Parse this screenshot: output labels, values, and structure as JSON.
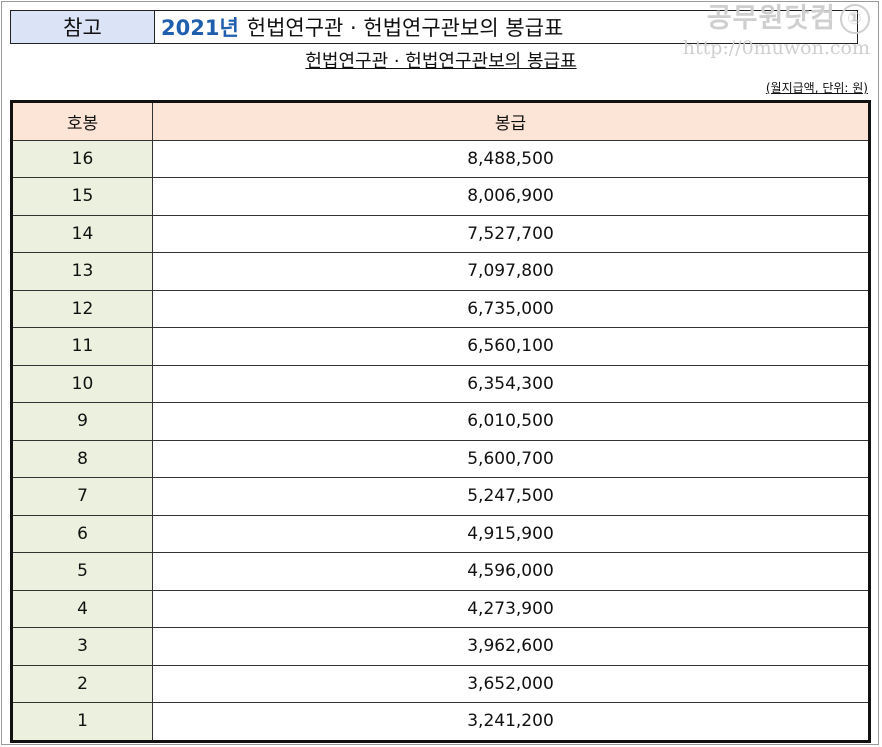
{
  "header": {
    "tag": "참고",
    "year": "2021년",
    "title": "헌법연구관 · 헌법연구관보의 봉급표"
  },
  "watermark": {
    "name": "공무원닷컴",
    "icon": "①",
    "url": "http://0muwon.com"
  },
  "subtitle": "헌법연구관 · 헌법연구관보의 봉급표",
  "unit_note": "(월지급액, 단위: 원)",
  "table": {
    "columns": [
      "호봉",
      "봉급"
    ],
    "rows": [
      {
        "step": "16",
        "pay": "8,488,500"
      },
      {
        "step": "15",
        "pay": "8,006,900"
      },
      {
        "step": "14",
        "pay": "7,527,700"
      },
      {
        "step": "13",
        "pay": "7,097,800"
      },
      {
        "step": "12",
        "pay": "6,735,000"
      },
      {
        "step": "11",
        "pay": "6,560,100"
      },
      {
        "step": "10",
        "pay": "6,354,300"
      },
      {
        "step": "9",
        "pay": "6,010,500"
      },
      {
        "step": "8",
        "pay": "5,600,700"
      },
      {
        "step": "7",
        "pay": "5,247,500"
      },
      {
        "step": "6",
        "pay": "4,915,900"
      },
      {
        "step": "5",
        "pay": "4,596,000"
      },
      {
        "step": "4",
        "pay": "4,273,900"
      },
      {
        "step": "3",
        "pay": "3,962,600"
      },
      {
        "step": "2",
        "pay": "3,652,000"
      },
      {
        "step": "1",
        "pay": "3,241,200"
      }
    ]
  },
  "colors": {
    "tag_bg": "#dbe4f6",
    "year_text": "#1f5fae",
    "header_row_bg": "#fce4d6",
    "step_col_bg": "#ebf1de"
  }
}
